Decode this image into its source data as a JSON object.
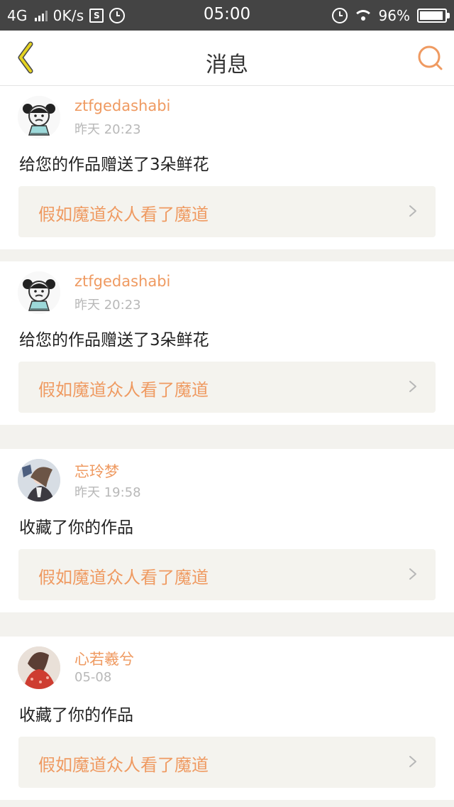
{
  "status_bar": {
    "network": "4G",
    "speed": "0K/s",
    "time": "05:00",
    "battery": "96%"
  },
  "navbar": {
    "title": "消息"
  },
  "notifications": [
    {
      "username": "ztfgedashabi",
      "time": "昨天 20:23",
      "message": "给您的作品赠送了3朵鲜花",
      "work_title": "假如魔道众人看了魔道"
    },
    {
      "username": "ztfgedashabi",
      "time": "昨天 20:23",
      "message": "给您的作品赠送了3朵鲜花",
      "work_title": "假如魔道众人看了魔道"
    },
    {
      "username": "忘玲梦",
      "time": "昨天 19:58",
      "message": "收藏了你的作品",
      "work_title": "假如魔道众人看了魔道"
    },
    {
      "username": "心若羲兮",
      "time": "05-08",
      "message": "收藏了你的作品",
      "work_title": "假如魔道众人看了魔道"
    }
  ],
  "colors": {
    "accent": "#ef9a61",
    "status_bar": "#444444",
    "background": "#f3f2ee",
    "link_card": "#f4f3ee"
  },
  "icons": {
    "back": "chevron-left-icon",
    "search": "search-icon",
    "arrow": "chevron-right-icon",
    "wifi": "wifi-icon",
    "battery": "battery-icon",
    "alarm": "alarm-icon"
  }
}
